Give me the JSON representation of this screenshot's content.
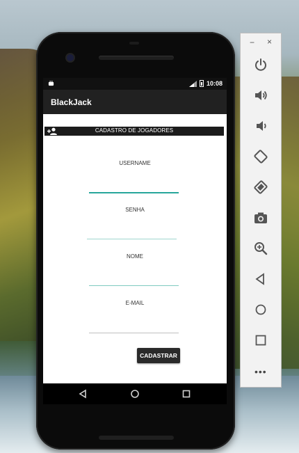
{
  "status_bar": {
    "time": "10:08"
  },
  "app_bar": {
    "title": "BlackJack"
  },
  "header": {
    "title": "CADASTRO DE JOGADORES",
    "icon": "person-add-icon"
  },
  "form": {
    "fields": [
      {
        "label": "USERNAME",
        "value": ""
      },
      {
        "label": "SENHA",
        "value": ""
      },
      {
        "label": "NOME",
        "value": ""
      },
      {
        "label": "E-MAIL",
        "value": ""
      }
    ],
    "submit_label": "CADASTRAR"
  },
  "emulator": {
    "minimize": "−",
    "close": "×",
    "more": "•••"
  },
  "colors": {
    "accent": "#26a69a",
    "app_bar": "#212121",
    "button": "#2a2a2a"
  }
}
